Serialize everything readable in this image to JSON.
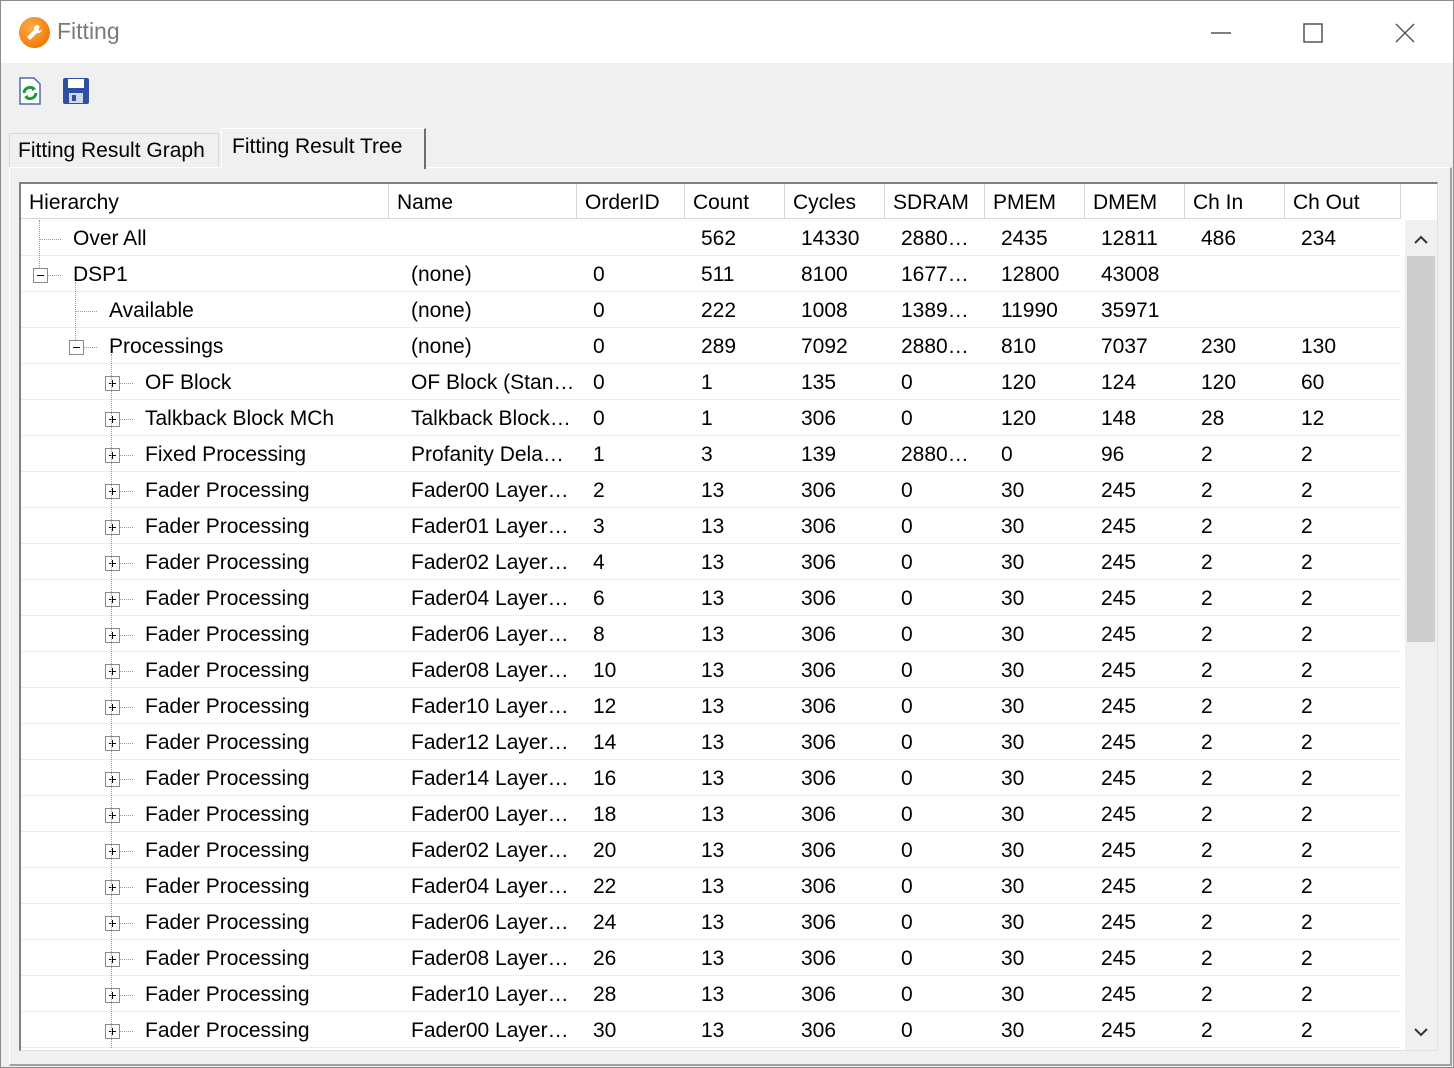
{
  "window": {
    "title": "Fitting"
  },
  "tabs": [
    {
      "label": "Fitting Result Graph",
      "active": false
    },
    {
      "label": "Fitting Result Tree",
      "active": true
    }
  ],
  "columns": [
    "Hierarchy",
    "Name",
    "OrderID",
    "Count",
    "Cycles",
    "SDRAM",
    "PMEM",
    "DMEM",
    "Ch In",
    "Ch Out"
  ],
  "rows": [
    {
      "level": 0,
      "expander": "none",
      "hierarchy": "Over All",
      "name": "",
      "order": "",
      "count": "562",
      "cycles": "14330",
      "sdram": "2880…",
      "pmem": "2435",
      "dmem": "12811",
      "chin": "486",
      "chout": "234"
    },
    {
      "level": 0,
      "expander": "minus",
      "hierarchy": "DSP1",
      "name": "(none)",
      "order": "0",
      "count": "511",
      "cycles": "8100",
      "sdram": "1677…",
      "pmem": "12800",
      "dmem": "43008",
      "chin": "",
      "chout": ""
    },
    {
      "level": 1,
      "expander": "none",
      "hierarchy": "Available",
      "name": "(none)",
      "order": "0",
      "count": "222",
      "cycles": "1008",
      "sdram": "1389…",
      "pmem": "11990",
      "dmem": "35971",
      "chin": "",
      "chout": ""
    },
    {
      "level": 1,
      "expander": "minus",
      "hierarchy": "Processings",
      "name": "(none)",
      "order": "0",
      "count": "289",
      "cycles": "7092",
      "sdram": "2880…",
      "pmem": "810",
      "dmem": "7037",
      "chin": "230",
      "chout": "130"
    },
    {
      "level": 2,
      "expander": "plus",
      "hierarchy": "OF Block",
      "name": "OF Block (Stan…",
      "order": "0",
      "count": "1",
      "cycles": "135",
      "sdram": "0",
      "pmem": "120",
      "dmem": "124",
      "chin": "120",
      "chout": "60"
    },
    {
      "level": 2,
      "expander": "plus",
      "hierarchy": "Talkback Block MCh",
      "name": "Talkback Block…",
      "order": "0",
      "count": "1",
      "cycles": "306",
      "sdram": "0",
      "pmem": "120",
      "dmem": "148",
      "chin": "28",
      "chout": "12"
    },
    {
      "level": 2,
      "expander": "plus",
      "hierarchy": "Fixed Processing",
      "name": "Profanity Dela…",
      "order": "1",
      "count": "3",
      "cycles": "139",
      "sdram": "2880…",
      "pmem": "0",
      "dmem": "96",
      "chin": "2",
      "chout": "2"
    },
    {
      "level": 2,
      "expander": "plus",
      "hierarchy": "Fader Processing",
      "name": "Fader00 Layer…",
      "order": "2",
      "count": "13",
      "cycles": "306",
      "sdram": "0",
      "pmem": "30",
      "dmem": "245",
      "chin": "2",
      "chout": "2"
    },
    {
      "level": 2,
      "expander": "plus",
      "hierarchy": "Fader Processing",
      "name": "Fader01 Layer…",
      "order": "3",
      "count": "13",
      "cycles": "306",
      "sdram": "0",
      "pmem": "30",
      "dmem": "245",
      "chin": "2",
      "chout": "2"
    },
    {
      "level": 2,
      "expander": "plus",
      "hierarchy": "Fader Processing",
      "name": "Fader02 Layer…",
      "order": "4",
      "count": "13",
      "cycles": "306",
      "sdram": "0",
      "pmem": "30",
      "dmem": "245",
      "chin": "2",
      "chout": "2"
    },
    {
      "level": 2,
      "expander": "plus",
      "hierarchy": "Fader Processing",
      "name": "Fader04 Layer…",
      "order": "6",
      "count": "13",
      "cycles": "306",
      "sdram": "0",
      "pmem": "30",
      "dmem": "245",
      "chin": "2",
      "chout": "2"
    },
    {
      "level": 2,
      "expander": "plus",
      "hierarchy": "Fader Processing",
      "name": "Fader06 Layer…",
      "order": "8",
      "count": "13",
      "cycles": "306",
      "sdram": "0",
      "pmem": "30",
      "dmem": "245",
      "chin": "2",
      "chout": "2"
    },
    {
      "level": 2,
      "expander": "plus",
      "hierarchy": "Fader Processing",
      "name": "Fader08 Layer…",
      "order": "10",
      "count": "13",
      "cycles": "306",
      "sdram": "0",
      "pmem": "30",
      "dmem": "245",
      "chin": "2",
      "chout": "2"
    },
    {
      "level": 2,
      "expander": "plus",
      "hierarchy": "Fader Processing",
      "name": "Fader10 Layer…",
      "order": "12",
      "count": "13",
      "cycles": "306",
      "sdram": "0",
      "pmem": "30",
      "dmem": "245",
      "chin": "2",
      "chout": "2"
    },
    {
      "level": 2,
      "expander": "plus",
      "hierarchy": "Fader Processing",
      "name": "Fader12 Layer…",
      "order": "14",
      "count": "13",
      "cycles": "306",
      "sdram": "0",
      "pmem": "30",
      "dmem": "245",
      "chin": "2",
      "chout": "2"
    },
    {
      "level": 2,
      "expander": "plus",
      "hierarchy": "Fader Processing",
      "name": "Fader14 Layer…",
      "order": "16",
      "count": "13",
      "cycles": "306",
      "sdram": "0",
      "pmem": "30",
      "dmem": "245",
      "chin": "2",
      "chout": "2"
    },
    {
      "level": 2,
      "expander": "plus",
      "hierarchy": "Fader Processing",
      "name": "Fader00 Layer…",
      "order": "18",
      "count": "13",
      "cycles": "306",
      "sdram": "0",
      "pmem": "30",
      "dmem": "245",
      "chin": "2",
      "chout": "2"
    },
    {
      "level": 2,
      "expander": "plus",
      "hierarchy": "Fader Processing",
      "name": "Fader02 Layer…",
      "order": "20",
      "count": "13",
      "cycles": "306",
      "sdram": "0",
      "pmem": "30",
      "dmem": "245",
      "chin": "2",
      "chout": "2"
    },
    {
      "level": 2,
      "expander": "plus",
      "hierarchy": "Fader Processing",
      "name": "Fader04 Layer…",
      "order": "22",
      "count": "13",
      "cycles": "306",
      "sdram": "0",
      "pmem": "30",
      "dmem": "245",
      "chin": "2",
      "chout": "2"
    },
    {
      "level": 2,
      "expander": "plus",
      "hierarchy": "Fader Processing",
      "name": "Fader06 Layer…",
      "order": "24",
      "count": "13",
      "cycles": "306",
      "sdram": "0",
      "pmem": "30",
      "dmem": "245",
      "chin": "2",
      "chout": "2"
    },
    {
      "level": 2,
      "expander": "plus",
      "hierarchy": "Fader Processing",
      "name": "Fader08 Layer…",
      "order": "26",
      "count": "13",
      "cycles": "306",
      "sdram": "0",
      "pmem": "30",
      "dmem": "245",
      "chin": "2",
      "chout": "2"
    },
    {
      "level": 2,
      "expander": "plus",
      "hierarchy": "Fader Processing",
      "name": "Fader10 Layer…",
      "order": "28",
      "count": "13",
      "cycles": "306",
      "sdram": "0",
      "pmem": "30",
      "dmem": "245",
      "chin": "2",
      "chout": "2"
    },
    {
      "level": 2,
      "expander": "plus",
      "hierarchy": "Fader Processing",
      "name": "Fader00 Layer…",
      "order": "30",
      "count": "13",
      "cycles": "306",
      "sdram": "0",
      "pmem": "30",
      "dmem": "245",
      "chin": "2",
      "chout": "2"
    }
  ]
}
